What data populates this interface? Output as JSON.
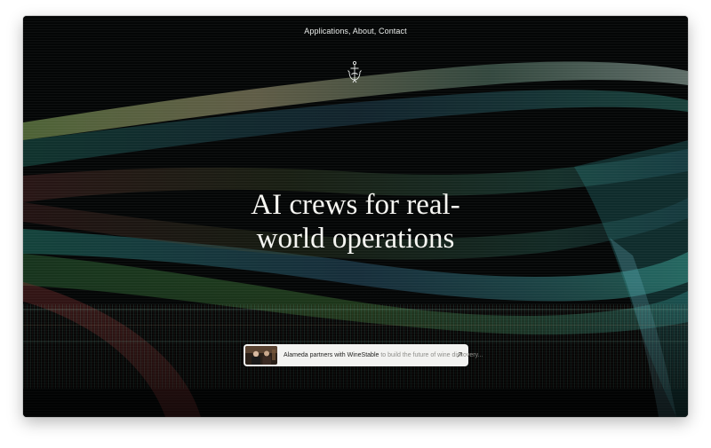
{
  "nav": {
    "links": [
      "Applications",
      "About",
      "Contact"
    ],
    "separator": ", "
  },
  "logo": {
    "icon": "anchor-crest-icon"
  },
  "hero": {
    "headline_line1": "AI crews for real-",
    "headline_line2": "world operations"
  },
  "announcement": {
    "highlight": "Alameda partners with WineStable",
    "rest": " to build the future of wine discovery...",
    "icon": "arrow-up-right-icon"
  },
  "colors": {
    "background": "#040606",
    "text": "#f6f6f2",
    "card": "#f3f3f1",
    "accent_teal": "#2f9b8f",
    "accent_green": "#3f8a3a",
    "accent_red": "#7a2a2a"
  }
}
